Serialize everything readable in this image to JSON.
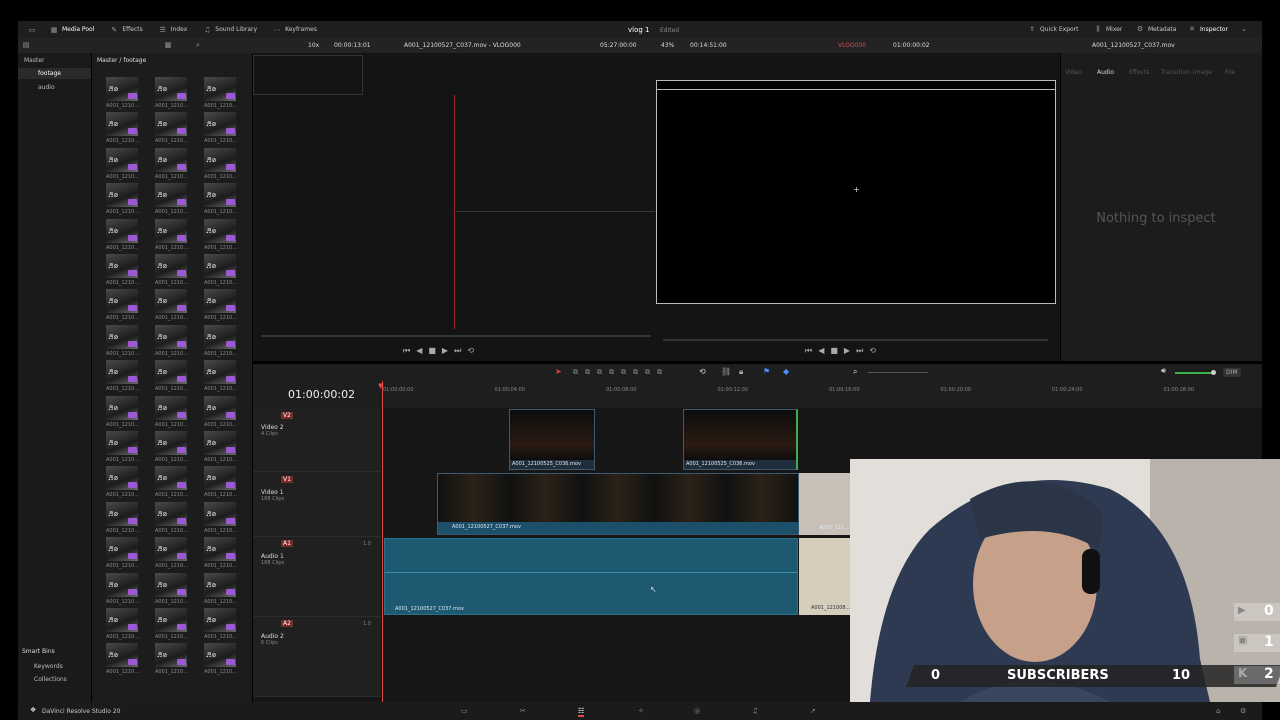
{
  "menu": {
    "media_pool": "Media Pool",
    "effects": "Effects",
    "index": "Index",
    "sound_library": "Sound Library",
    "keyframes": "Keyframes",
    "project": "vlog 1",
    "edited": "Edited",
    "quick_export": "Quick Export",
    "mixer": "Mixer",
    "metadata": "Metadata",
    "inspector": "Inspector"
  },
  "toolbar": {
    "zoom": "10x",
    "source_tc": "00:00:13:01",
    "source_clip": "A001_12100527_C037.mov - VLOG000",
    "source_dur": "05:27:00:00",
    "viewer_zoom": "43%",
    "timeline_dur": "00:14:51:00",
    "timeline_name": "VLOG000",
    "timeline_tc": "01:00:00:02",
    "inspector_clip": "A001_12100527_C037.mov"
  },
  "bins": {
    "master": "Master",
    "footage": "footage",
    "audio": "audio",
    "smart_bins": "Smart Bins",
    "keywords": "Keywords",
    "collections": "Collections"
  },
  "pool": {
    "path": "Master / footage",
    "thumb_label": "A001_1210..."
  },
  "inspector": {
    "tabs": [
      "Video",
      "Audio",
      "Effects",
      "Transition",
      "Image",
      "File"
    ],
    "empty": "Nothing to inspect"
  },
  "timeline": {
    "timecode": "01:00:00:02",
    "ruler": [
      "01:00:00:00",
      "01:00:04:00",
      "01:00:08:00",
      "01:00:12:00",
      "01:00:16:00",
      "01:00:20:00",
      "01:00:24:00",
      "01:00:28:00"
    ],
    "tracks": {
      "v2": {
        "id": "V2",
        "name": "Video 2",
        "count": "4 Clips"
      },
      "v1": {
        "id": "V1",
        "name": "Video 1",
        "count": "188 Clips"
      },
      "a1": {
        "id": "A1",
        "name": "Audio 1",
        "count": "188 Clips",
        "level": "1.0"
      },
      "a2": {
        "id": "A2",
        "name": "Audio 2",
        "count": "6 Clips",
        "level": "1.0"
      }
    },
    "clips": {
      "v2a": "A001_12100525_C036.mov",
      "v2b": "A001_12100525_C036.mov",
      "v1": "A001_12100527_C037.mov",
      "v1b": "A001_121...",
      "a1": "A001_12100527_C037.mov",
      "a1b": "A001_121008..."
    },
    "dim": "DIM"
  },
  "overlay": {
    "left_num": "0",
    "subscribers": "SUBSCRIBERS",
    "right_num": "10",
    "stat1": "0",
    "stat2": "1",
    "stat3": "2"
  },
  "app": {
    "name": "DaVinci Resolve Studio 20"
  }
}
